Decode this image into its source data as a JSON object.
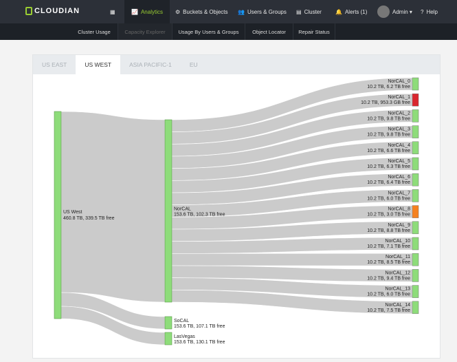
{
  "nav": {
    "brand": "CLOUDIAN",
    "items": [
      {
        "label": "Analytics",
        "icon": "chart-line-icon",
        "active": true
      },
      {
        "label": "Buckets & Objects",
        "icon": "gear-icon"
      },
      {
        "label": "Users & Groups",
        "icon": "users-icon"
      },
      {
        "label": "Cluster",
        "icon": "server-icon"
      },
      {
        "label": "Alerts (1)",
        "icon": "bell-icon"
      },
      {
        "label": "Admin ▾",
        "icon": "avatar"
      },
      {
        "label": "Help",
        "icon": "question-icon"
      }
    ]
  },
  "subnav": [
    {
      "label": "Cluster Usage"
    },
    {
      "label": "Capacity Explorer",
      "active": true
    },
    {
      "label": "Usage By Users & Groups"
    },
    {
      "label": "Object Locator"
    },
    {
      "label": "Repair Status"
    }
  ],
  "tabs": [
    {
      "label": "US EAST"
    },
    {
      "label": "US WEST",
      "active": true
    },
    {
      "label": "ASIA PACIFIC-1"
    },
    {
      "label": "EU"
    }
  ],
  "colors": {
    "ok": "#8edc7a",
    "critical": "#d9262e",
    "warning": "#f58220",
    "link": "#c8c8c8"
  },
  "sankey": {
    "root": {
      "name": "US West",
      "detail": "460.8 TB, 339.5 TB free"
    },
    "regions": [
      {
        "name": "NorCAL",
        "detail": "153.6 TB, 102.3 TB free"
      },
      {
        "name": "SoCAL",
        "detail": "153.6 TB, 107.1 TB free"
      },
      {
        "name": "LasVegas",
        "detail": "153.6 TB, 130.1 TB free"
      }
    ],
    "nodes": [
      {
        "name": "NorCAL_0",
        "detail": "10.2 TB, 6.2 TB free",
        "status": "ok"
      },
      {
        "name": "NorCAL_1",
        "detail": "10.2 TB, 953.3 GB free",
        "status": "critical"
      },
      {
        "name": "NorCAL_2",
        "detail": "10.2 TB, 9.8 TB free",
        "status": "ok"
      },
      {
        "name": "NorCAL_3",
        "detail": "10.2 TB, 9.8 TB free",
        "status": "ok"
      },
      {
        "name": "NorCAL_4",
        "detail": "10.2 TB, 6.6 TB free",
        "status": "ok"
      },
      {
        "name": "NorCAL_5",
        "detail": "10.2 TB, 6.3 TB free",
        "status": "ok"
      },
      {
        "name": "NorCAL_6",
        "detail": "10.2 TB, 6.4 TB free",
        "status": "ok"
      },
      {
        "name": "NorCAL_7",
        "detail": "10.2 TB, 6.0 TB free",
        "status": "ok"
      },
      {
        "name": "NorCAL_8",
        "detail": "10.2 TB, 3.0 TB free",
        "status": "warning"
      },
      {
        "name": "NorCAL_9",
        "detail": "10.2 TB, 8.8 TB free",
        "status": "ok"
      },
      {
        "name": "NorCAL_10",
        "detail": "10.2 TB, 7.1 TB free",
        "status": "ok"
      },
      {
        "name": "NorCAL_11",
        "detail": "10.2 TB, 8.5 TB free",
        "status": "ok"
      },
      {
        "name": "NorCAL_12",
        "detail": "10.2 TB, 9.4 TB free",
        "status": "ok"
      },
      {
        "name": "NorCAL_13",
        "detail": "10.2 TB, 6.0 TB free",
        "status": "ok"
      },
      {
        "name": "NorCAL_14",
        "detail": "10.2 TB, 7.5 TB free",
        "status": "ok"
      }
    ]
  }
}
